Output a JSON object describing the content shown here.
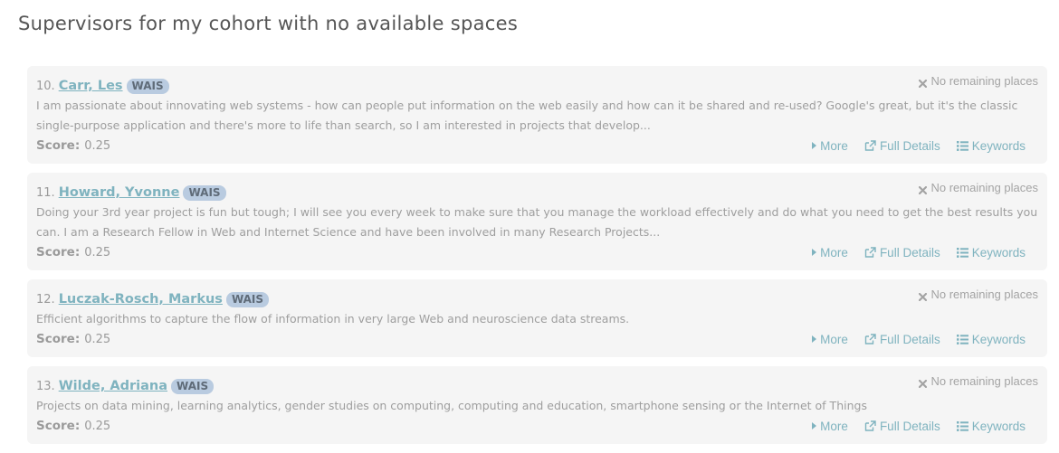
{
  "page": {
    "title": "Supervisors for my cohort with no available spaces"
  },
  "colors": {
    "link": "#7fb3bf",
    "badge_bg": "#b9cbe0",
    "card_bg": "#f5f5f5",
    "muted_text": "#9a9a9a"
  },
  "actions": {
    "more": "More",
    "full_details": "Full Details",
    "keywords": "Keywords"
  },
  "labels": {
    "score": "Score:",
    "status": "No remaining places"
  },
  "icons": {
    "status": "x-icon",
    "more": "caret-right-icon",
    "full_details": "external-link-icon",
    "keywords": "list-icon"
  },
  "supervisors": [
    {
      "number": "10.",
      "name": "Carr, Les",
      "group": "WAIS",
      "description": "I am passionate about innovating web systems - how can people put information on the web easily and how can it be shared and re-used? Google's great, but it's the classic single-purpose application and there's more to life than search, so I am interested in projects that develop...",
      "score": "0.25"
    },
    {
      "number": "11.",
      "name": "Howard, Yvonne",
      "group": "WAIS",
      "description": "Doing your 3rd year project is fun but tough; I will see you every week to make sure that you manage the workload effectively and do what you need to get the best results you can. I am a Research Fellow in Web and Internet Science and have been involved in many Research Projects...",
      "score": "0.25"
    },
    {
      "number": "12.",
      "name": "Luczak-Rosch, Markus",
      "group": "WAIS",
      "description": "Efficient algorithms to capture the flow of information in very large Web and neuroscience data streams.",
      "score": "0.25"
    },
    {
      "number": "13.",
      "name": "Wilde, Adriana",
      "group": "WAIS",
      "description": "Projects on data mining, learning analytics, gender studies on computing, computing and education, smartphone sensing or the Internet of Things",
      "score": "0.25"
    }
  ]
}
